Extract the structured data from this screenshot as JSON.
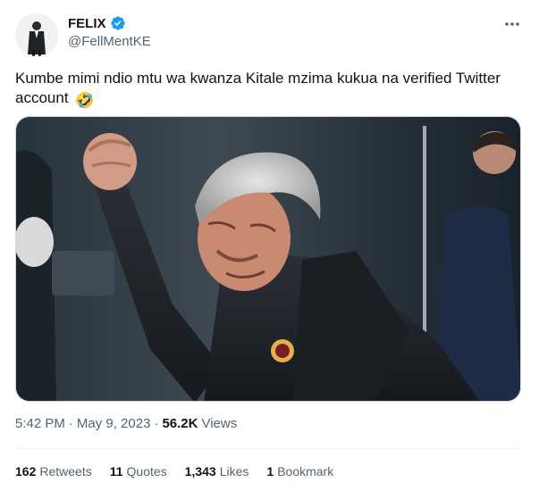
{
  "author": {
    "display_name": "FELIX",
    "handle": "@FellMentKE",
    "verified": true,
    "avatar_icon": "profile-photo-man-in-suit"
  },
  "tweet": {
    "text": "Kumbe mimi ndio mtu wa kwanza Kitale mzima kukua na verified Twitter account",
    "emoji": "🤣",
    "media_description_icon": "photo-crying-man-raising-fist"
  },
  "meta": {
    "time": "5:42 PM",
    "separator": "·",
    "date": "May 9, 2023",
    "views_count": "56.2K",
    "views_label": "Views"
  },
  "stats": {
    "retweets_count": "162",
    "retweets_label": "Retweets",
    "quotes_count": "11",
    "quotes_label": "Quotes",
    "likes_count": "1,343",
    "likes_label": "Likes",
    "bookmarks_count": "1",
    "bookmarks_label": "Bookmark"
  },
  "colors": {
    "text": "#0f1419",
    "secondary_text": "#536471",
    "verified_blue": "#1d9bf0",
    "divider": "#eff3f4"
  }
}
